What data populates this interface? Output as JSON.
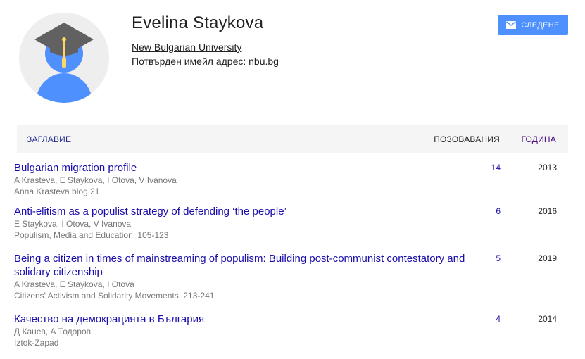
{
  "profile": {
    "name": "Evelina Staykova",
    "affiliation": "New Bulgarian University",
    "email": "Потвърден имейл адрес: nbu.bg"
  },
  "follow_button": {
    "label": "СЛЕДЕНЕ",
    "icon": "envelope-icon"
  },
  "table": {
    "headers": {
      "title": "Заглавие",
      "cites": "Позовавания",
      "year": "Година"
    },
    "rows": [
      {
        "title": "Bulgarian migration profile",
        "authors": "A Krasteva, E Staykova, I Otova, V Ivanova",
        "venue": "Anna Krasteva blog 21",
        "cites": "14",
        "year": "2013"
      },
      {
        "title": "Anti-elitism as a populist strategy of defending ‘the people’",
        "authors": "E Staykova, I Otova, V Ivanova",
        "venue": "Populism, Media and Education, 105-123",
        "cites": "6",
        "year": "2016"
      },
      {
        "title": "Being a citizen in times of mainstreaming of populism: Building post-communist contestatory and solidary citizenship",
        "authors": "A Krasteva, E Staykova, I Otova",
        "venue": "Citizens' Activism and Solidarity Movements, 213-241",
        "cites": "5",
        "year": "2019"
      },
      {
        "title": "Качество на демокрацията в България",
        "authors": "Д Канев, А Тодоров",
        "venue": "Iztok-Zapad",
        "cites": "4",
        "year": "2014"
      }
    ]
  },
  "colors": {
    "link": "#1a0dab",
    "button": "#4d90fe",
    "avatar_bg": "#f0f0f0",
    "avatar_person": "#4d90fe",
    "cap": "#616161",
    "tassel": "#fdd663"
  }
}
